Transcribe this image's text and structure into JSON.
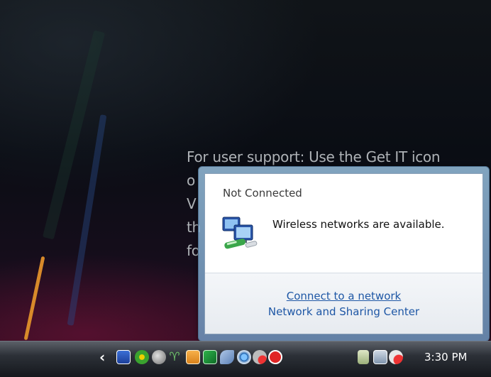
{
  "desktop": {
    "support_lines": [
      "For user support: Use the Get IT icon",
      "o",
      "V",
      "th",
      "fo"
    ]
  },
  "flyout": {
    "title": "Not Connected",
    "message": "Wireless networks are available.",
    "links": {
      "connect": "Connect to a network",
      "sharing_center": "Network and Sharing Center"
    },
    "icon": "wireless-network-icon"
  },
  "taskbar": {
    "show_hidden_icon": "chevron-left-icon",
    "tray_icons": [
      "security-shield-icon",
      "green-gear-icon",
      "update-globe-icon",
      "wifi-signal-icon",
      "messenger-icon",
      "chart-icon",
      "pen-tablet-icon",
      "network-status-icon",
      "network-disconnected-icon",
      "red-app-icon",
      "power-icon",
      "network-error-icon",
      "volume-muted-icon"
    ],
    "clock": "3:30 PM"
  },
  "colors": {
    "link": "#1e57a5",
    "flyout_border": "#4d6f8f",
    "taskbar": "#2c3037"
  }
}
